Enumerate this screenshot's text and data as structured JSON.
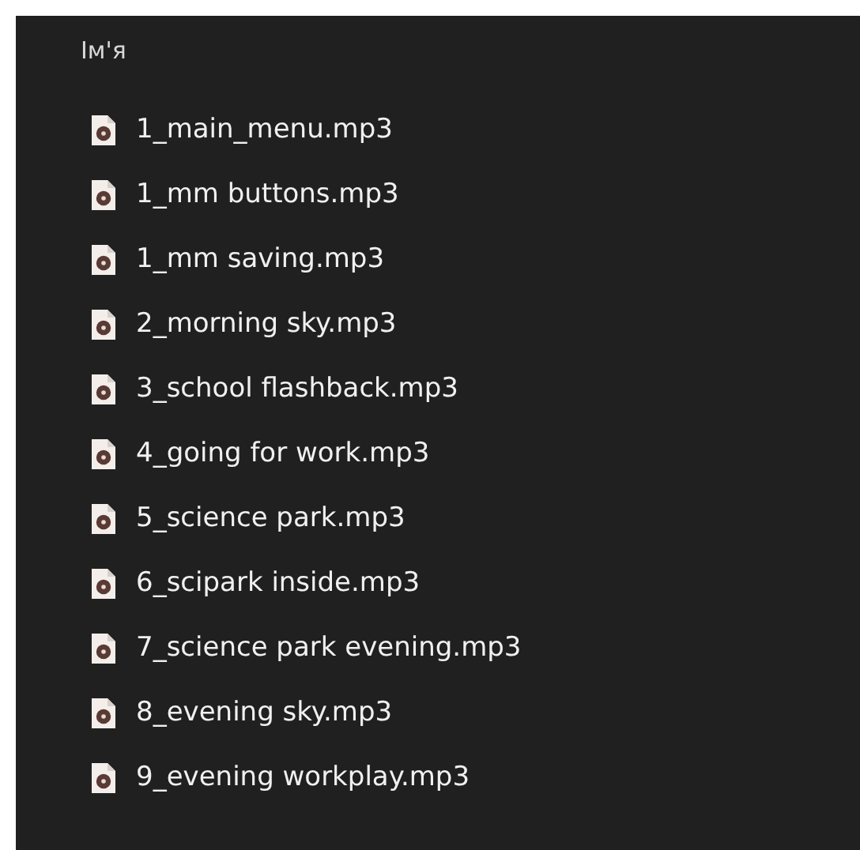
{
  "column_header": "Ім'я",
  "files": [
    {
      "name": "1_main_menu.mp3"
    },
    {
      "name": "1_mm buttons.mp3"
    },
    {
      "name": "1_mm saving.mp3"
    },
    {
      "name": "2_morning sky.mp3"
    },
    {
      "name": "3_school flashback.mp3"
    },
    {
      "name": "4_going for work.mp3"
    },
    {
      "name": "5_science park.mp3"
    },
    {
      "name": "6_scipark inside.mp3"
    },
    {
      "name": "7_science park evening.mp3"
    },
    {
      "name": "8_evening sky.mp3"
    },
    {
      "name": "9_evening workplay.mp3"
    }
  ]
}
